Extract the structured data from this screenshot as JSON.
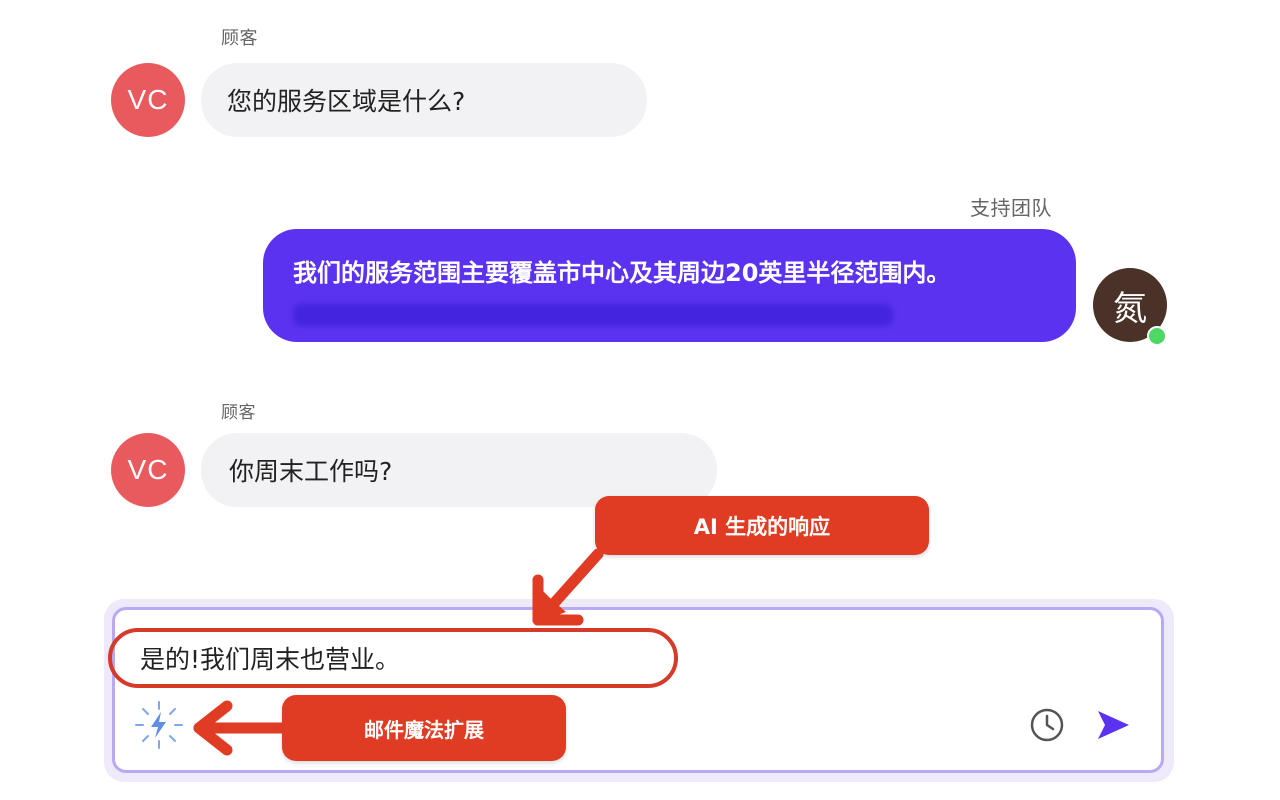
{
  "messages": [
    {
      "role": "customer",
      "sender": "顾客",
      "avatar_initials": "VC",
      "text": "您的服务区域是什么?"
    },
    {
      "role": "agent",
      "sender": "支持团队",
      "avatar_initial": "氮",
      "text": "我们的服务范围主要覆盖市中心及其周边20英里半径范围内。"
    },
    {
      "role": "customer",
      "sender": "顾客",
      "avatar_initials": "VC",
      "text": "你周末工作吗?"
    }
  ],
  "composer": {
    "draft_text": "是的!我们周末也营业。",
    "icons": {
      "magic": "magic-sparkle-icon",
      "schedule": "clock-icon",
      "send": "send-icon"
    }
  },
  "annotations": {
    "ai_response_label": "AI 生成的响应",
    "extension_label": "邮件魔法扩展"
  },
  "colors": {
    "customer_avatar": "#e85a5e",
    "agent_bubble": "#5b32f0",
    "callout": "#e03b23",
    "composer_border": "#b9a8f3",
    "online": "#4cd964"
  }
}
